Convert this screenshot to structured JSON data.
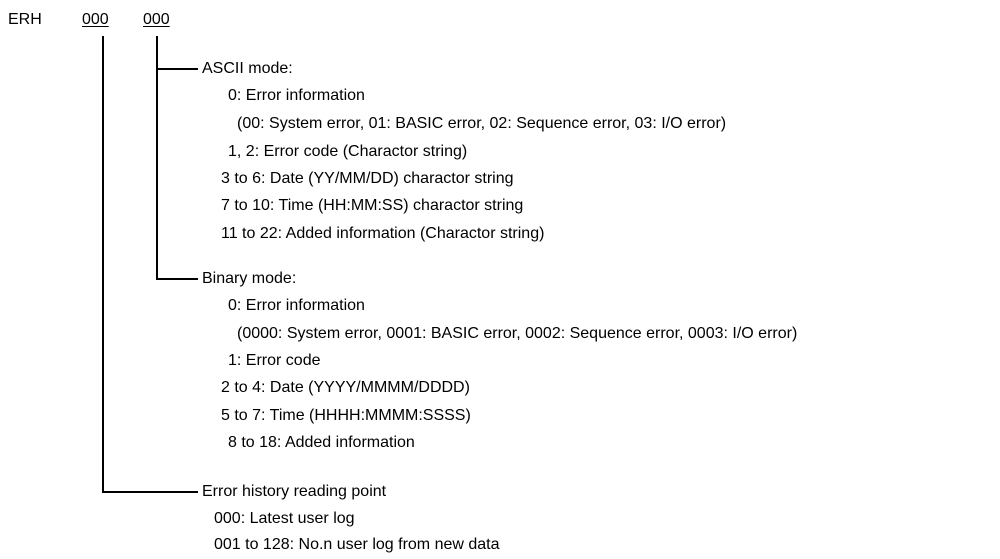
{
  "header": {
    "command": "ERH",
    "param1": "000",
    "param2": "000"
  },
  "ascii_section": {
    "title": "ASCII mode:",
    "lines": [
      "0: Error information",
      "(00: System error, 01: BASIC error, 02: Sequence error, 03: I/O error)",
      "1, 2: Error code (Charactor string)",
      "3 to 6: Date (YY/MM/DD) charactor string",
      "7 to 10: Time (HH:MM:SS) charactor string",
      "11 to 22: Added information (Charactor string)"
    ]
  },
  "binary_section": {
    "title": "Binary mode:",
    "lines": [
      "0: Error information",
      "(0000: System error, 0001: BASIC error, 0002: Sequence error, 0003: I/O error)",
      "1: Error code",
      "2 to 4: Date (YYYY/MMMM/DDDD)",
      "5 to 7: Time (HHHH:MMMM:SSSS)",
      "8 to 18: Added information"
    ]
  },
  "reading_point_section": {
    "title": "Error history reading point",
    "lines": [
      "000: Latest user log",
      "001 to 128: No.n user log from new data"
    ]
  }
}
